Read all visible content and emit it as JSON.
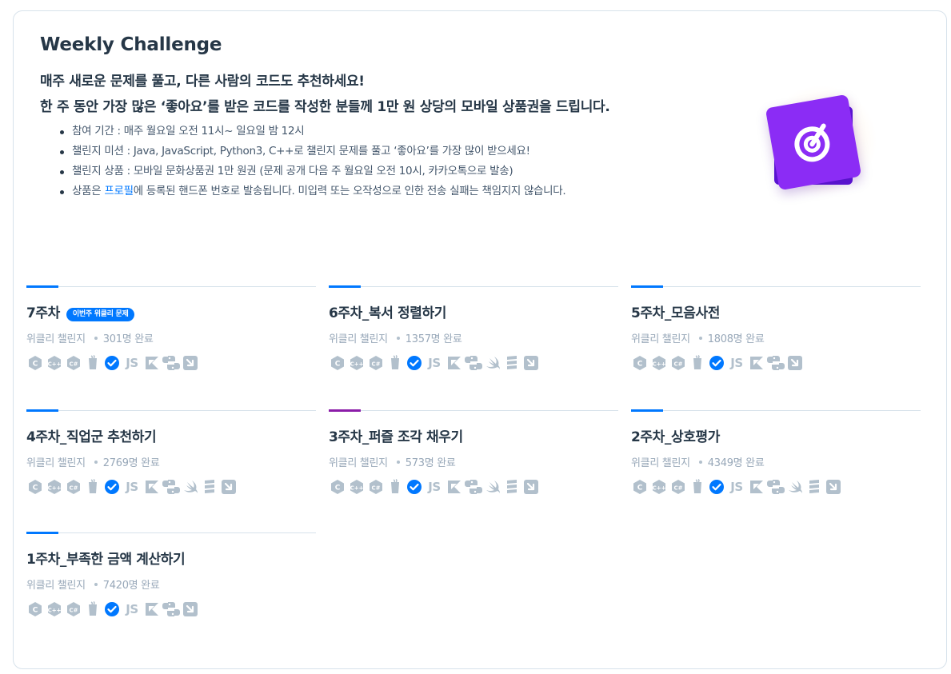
{
  "hero": {
    "title": "Weekly Challenge",
    "desc_line1": "매주 새로운 문제를 풀고, 다른 사람의 코드도 추천하세요!",
    "desc_line2": "한 주 동안 가장 많은 ‘좋아요’를 받은 코드를 작성한 분들께 1만 원 상당의 모바일 상품권을 드립니다.",
    "bullets": [
      "참여 기간 : 매주 월요일 오전 11시~ 일요일 밤 12시",
      "챌린지 미션 : Java, JavaScript, Python3, C++로 챌린지 문제를 풀고 ‘좋아요’를 가장 많이 받으세요!",
      "챌린지 상품 : 모바일 문화상품권 1만 원권 (문제 공개 다음 주 월요일 오전 10시, 카카오톡으로 발송)"
    ],
    "bullet4_before": "상품은 ",
    "bullet4_link": "프로필",
    "bullet4_after": "에 등록된 핸드폰 번호로 발송됩니다. 미입력 또는 오작성으로 인한 전송 실패는 책임지지 않습니다.",
    "art_icon": "target-icon",
    "art_color": "#8b2cf5"
  },
  "accent_blue": "#0078ff",
  "accent_purple": "#8b1ca8",
  "weeks": [
    {
      "title": "7주차",
      "badge": "이번주 위클리 문제",
      "category": "위클리 챌린지",
      "done": "301명 완료"
    },
    {
      "title": "6주차_복서 정렬하기",
      "category": "위클리 챌린지",
      "done": "1357명 완료"
    },
    {
      "title": "5주차_모음사전",
      "category": "위클리 챌린지",
      "done": "1808명 완료"
    },
    {
      "title": "4주차_직업군 추천하기",
      "category": "위클리 챌린지",
      "done": "2769명 완료"
    },
    {
      "title": "3주차_퍼즐 조각 채우기",
      "category": "위클리 챌린지",
      "done": "573명 완료"
    },
    {
      "title": "2주차_상호평가",
      "category": "위클리 챌린지",
      "done": "4349명 완료"
    },
    {
      "title": "1주차_부족한 금액 계산하기",
      "category": "위클리 챌린지",
      "done": "7420명 완료"
    }
  ],
  "js_label": "JS",
  "language_icons_long": [
    "c-icon",
    "cpp-icon",
    "csharp-icon",
    "java-icon",
    "javascript-check-icon",
    "js-icon",
    "kotlin-icon",
    "python3-icon",
    "swift-icon",
    "scala-icon",
    "go-icon"
  ],
  "language_icons_short": [
    "c-icon",
    "cpp-icon",
    "csharp-icon",
    "java-icon",
    "javascript-check-icon",
    "js-icon",
    "kotlin-icon",
    "python3-icon",
    "go-icon"
  ]
}
